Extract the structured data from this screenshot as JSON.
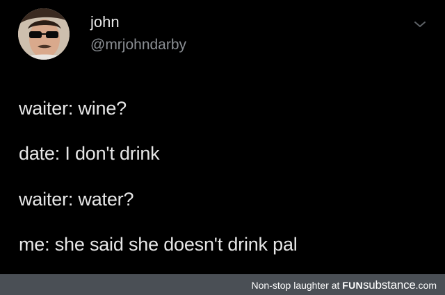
{
  "tweet": {
    "author": {
      "name": "john",
      "handle": "@mrjohndarby"
    },
    "lines": [
      "waiter: wine?",
      "date: I don't drink",
      "waiter: water?",
      "me: she said she doesn't drink pal"
    ],
    "menu_icon": "chevron-down-icon"
  },
  "footer": {
    "caption": "Non-stop laughter at",
    "brand_fun": "FUN",
    "brand_substance": "substance",
    "brand_domain": ".com"
  },
  "colors": {
    "background": "#000000",
    "text": "#e6e6e6",
    "handle": "#8b8f94",
    "footer_bg": "#4a4f55"
  }
}
